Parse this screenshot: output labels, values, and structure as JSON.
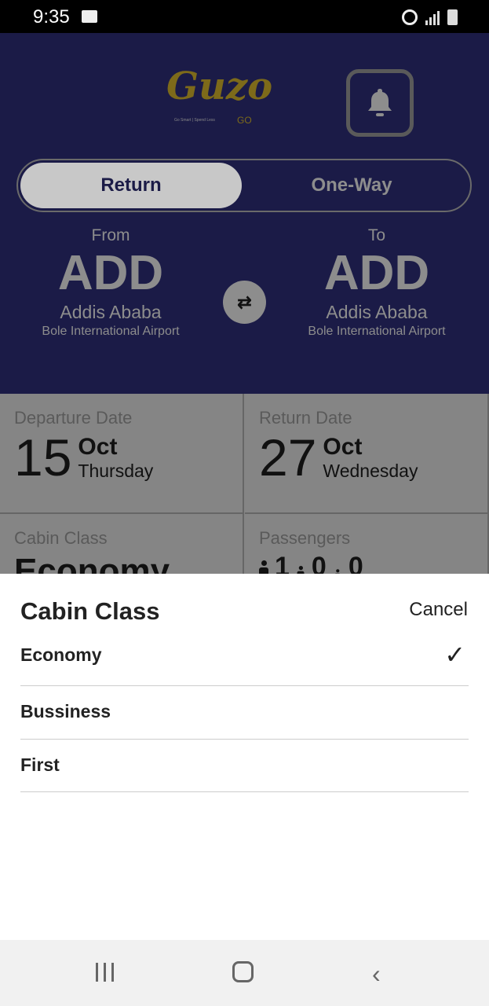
{
  "status": {
    "time": "9:35"
  },
  "header": {
    "logo_text": "Guzo",
    "logo_tagline": "Go Smart | Spend Less",
    "logo_go": "GO"
  },
  "trip_toggle": {
    "return_label": "Return",
    "oneway_label": "One-Way"
  },
  "from": {
    "label": "From",
    "code": "ADD",
    "city": "Addis Ababa",
    "airport": "Bole International Airport"
  },
  "to": {
    "label": "To",
    "code": "ADD",
    "city": "Addis Ababa",
    "airport": "Bole International Airport"
  },
  "departure": {
    "label": "Departure Date",
    "day": "15",
    "month": "Oct",
    "weekday": "Thursday"
  },
  "return": {
    "label": "Return Date",
    "day": "27",
    "month": "Oct",
    "weekday": "Wednesday"
  },
  "cabin": {
    "label": "Cabin Class",
    "value": "Economy"
  },
  "passengers": {
    "label": "Passengers",
    "adults": "1",
    "children": "0",
    "infants": "0"
  },
  "sheet": {
    "title": "Cabin Class",
    "cancel": "Cancel",
    "options": [
      {
        "label": "Economy",
        "selected": true
      },
      {
        "label": "Bussiness"
      },
      {
        "label": "First"
      }
    ]
  }
}
